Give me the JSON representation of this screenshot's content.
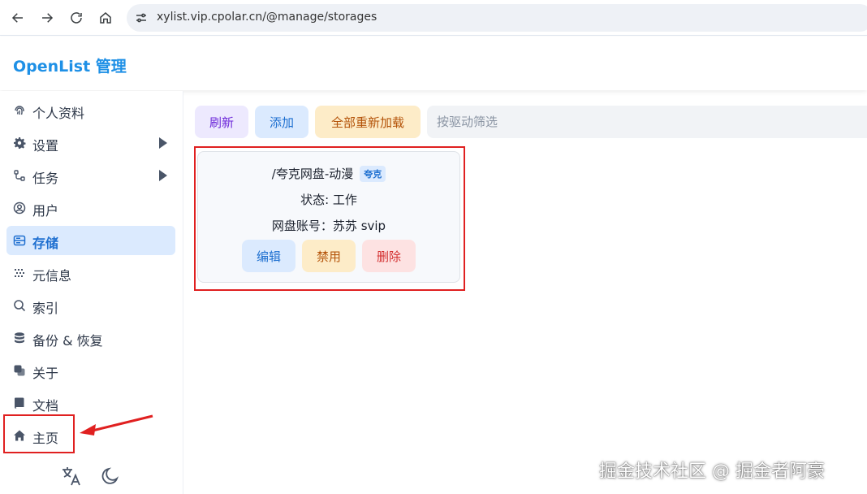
{
  "browser": {
    "url": "xylist.vip.cpolar.cn/@manage/storages"
  },
  "header": {
    "title": "OpenList 管理"
  },
  "sidebar": {
    "items": [
      {
        "label": "个人资料",
        "icon": "fingerprint-icon"
      },
      {
        "label": "设置",
        "icon": "gear-icon"
      },
      {
        "label": "任务",
        "icon": "tasks-icon"
      },
      {
        "label": "用户",
        "icon": "user-circle-icon"
      },
      {
        "label": "存储",
        "icon": "database-icon"
      },
      {
        "label": "元信息",
        "icon": "meta-icon"
      },
      {
        "label": "索引",
        "icon": "search-icon"
      },
      {
        "label": "备份 & 恢复",
        "icon": "backup-icon"
      },
      {
        "label": "关于",
        "icon": "copy-icon"
      },
      {
        "label": "文档",
        "icon": "book-icon"
      },
      {
        "label": "主页",
        "icon": "home-icon"
      }
    ],
    "active": "存储"
  },
  "toolbar": {
    "refresh_label": "刷新",
    "add_label": "添加",
    "reload_all_label": "全部重新加载",
    "filter_placeholder": "按驱动筛选"
  },
  "storage_card": {
    "mount_path": "/夸克网盘-动漫",
    "driver_badge": "夸克",
    "status": "状态: 工作",
    "account": "网盘账号：苏苏 svip",
    "edit_label": "编辑",
    "disable_label": "禁用",
    "delete_label": "删除"
  },
  "watermark": "掘金技术社区 @ 掘金者阿豪",
  "colors": {
    "accent": "#1e90e6",
    "highlight_red": "#e02020"
  }
}
